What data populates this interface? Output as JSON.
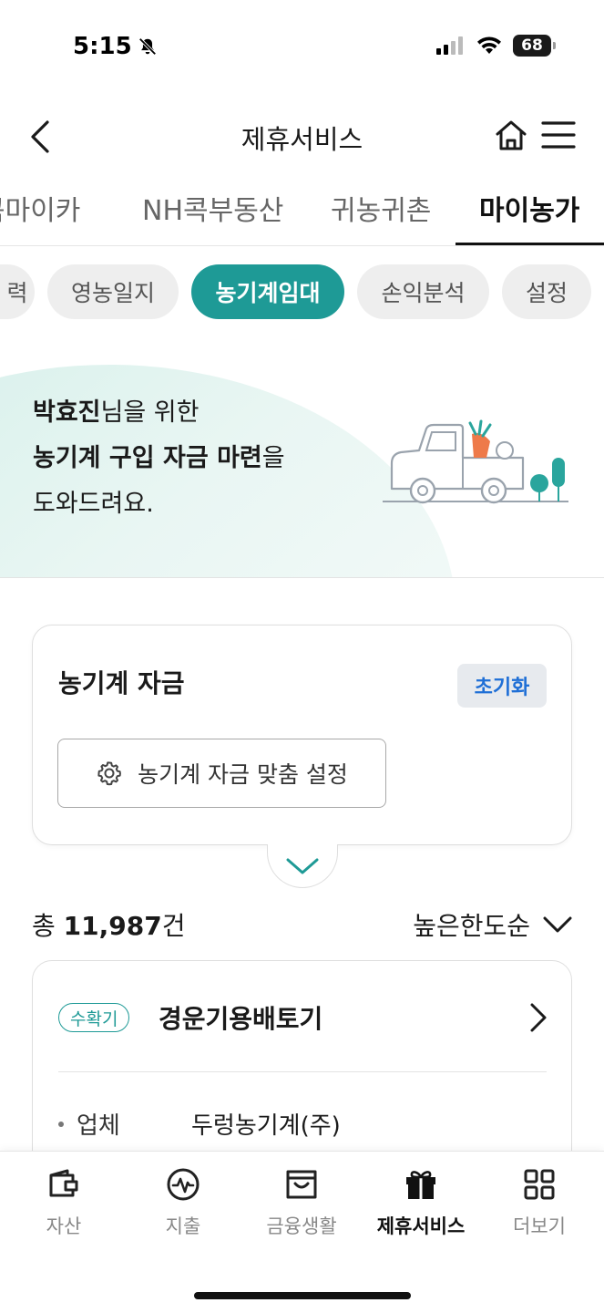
{
  "status": {
    "time": "5:15",
    "battery": "68"
  },
  "header": {
    "title": "제휴서비스"
  },
  "top_tabs": [
    {
      "label": "콕마이카"
    },
    {
      "label": "NH콕부동산"
    },
    {
      "label": "귀농귀촌"
    },
    {
      "label": "마이농가"
    }
  ],
  "chips": [
    {
      "label": "력"
    },
    {
      "label": "영농일지"
    },
    {
      "label": "농기계임대"
    },
    {
      "label": "손익분석"
    },
    {
      "label": "설정"
    }
  ],
  "banner": {
    "name": "박효진",
    "line1_suffix": "님을 위한",
    "line2_bold": "농기계 구입 자금 마련",
    "line2_suffix": "을",
    "line3": "도와드려요."
  },
  "fund_card": {
    "title": "농기계 자금",
    "reset_label": "초기화",
    "custom_label": "농기계 자금 맞춤 설정"
  },
  "results": {
    "prefix": "총 ",
    "count": "11,987",
    "suffix": "건",
    "sort_label": "높은한도순"
  },
  "item": {
    "badge": "수확기",
    "name": "경운기용배토기",
    "fields": [
      {
        "key": "업체",
        "value": "두렁농기계(주)"
      }
    ]
  },
  "bottom_nav": [
    {
      "label": "자산",
      "icon": "wallet-icon"
    },
    {
      "label": "지출",
      "icon": "pulse-icon"
    },
    {
      "label": "금융생활",
      "icon": "shopping-bag-icon"
    },
    {
      "label": "제휴서비스",
      "icon": "gift-icon"
    },
    {
      "label": "더보기",
      "icon": "grid-icon"
    }
  ],
  "colors": {
    "accent": "#1e9a96",
    "reset_text": "#1f6fd6"
  }
}
